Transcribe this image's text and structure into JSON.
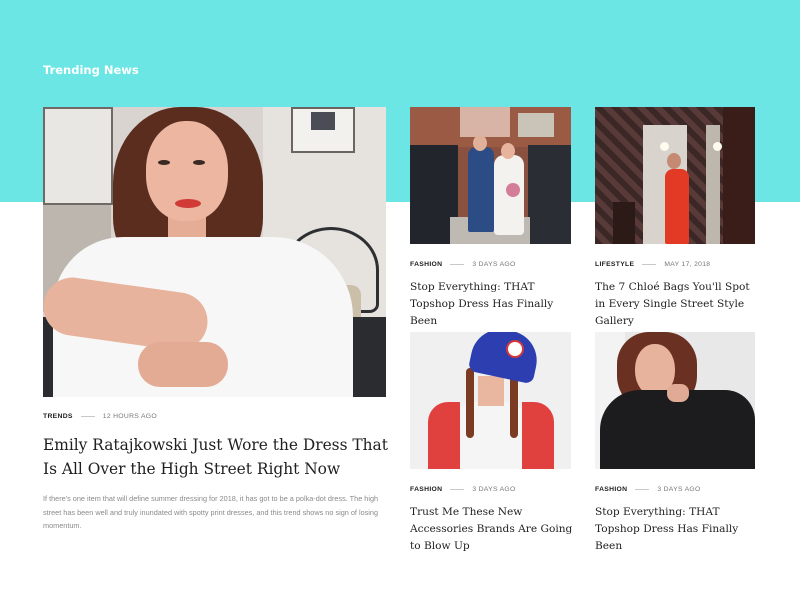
{
  "section": {
    "title": "Trending News"
  },
  "colors": {
    "accent": "#6be6e4",
    "heading": "#1f1f1f",
    "muted": "#8a8a8a"
  },
  "featured": {
    "category": "TRENDS",
    "time": "12 HOURS AGO",
    "title": "Emily Ratajkowski Just Wore the Dress That Is All Over the High Street Right Now",
    "excerpt": "If there's one item that will define summer dressing for 2018, it has got to be a polka-dot dress. The high street has been well and truly inundated with spotty print dresses, and this trend shows no sign of losing momentum."
  },
  "articles": [
    {
      "category": "FASHION",
      "time": "3 DAYS AGO",
      "title": "Stop Everything: THAT Topshop Dress Has Finally Been"
    },
    {
      "category": "LIFESTYLE",
      "time": "MAY 17, 2018",
      "title": "The 7 Chloé Bags You'll Spot in Every Single Street Style Gallery"
    },
    {
      "category": "FASHION",
      "time": "3 DAYS AGO",
      "title": "Trust Me These New Accessories Brands Are Going to Blow Up"
    },
    {
      "category": "FASHION",
      "time": "3 DAYS AGO",
      "title": "Stop Everything: THAT Topshop Dress Has Finally Been"
    }
  ]
}
